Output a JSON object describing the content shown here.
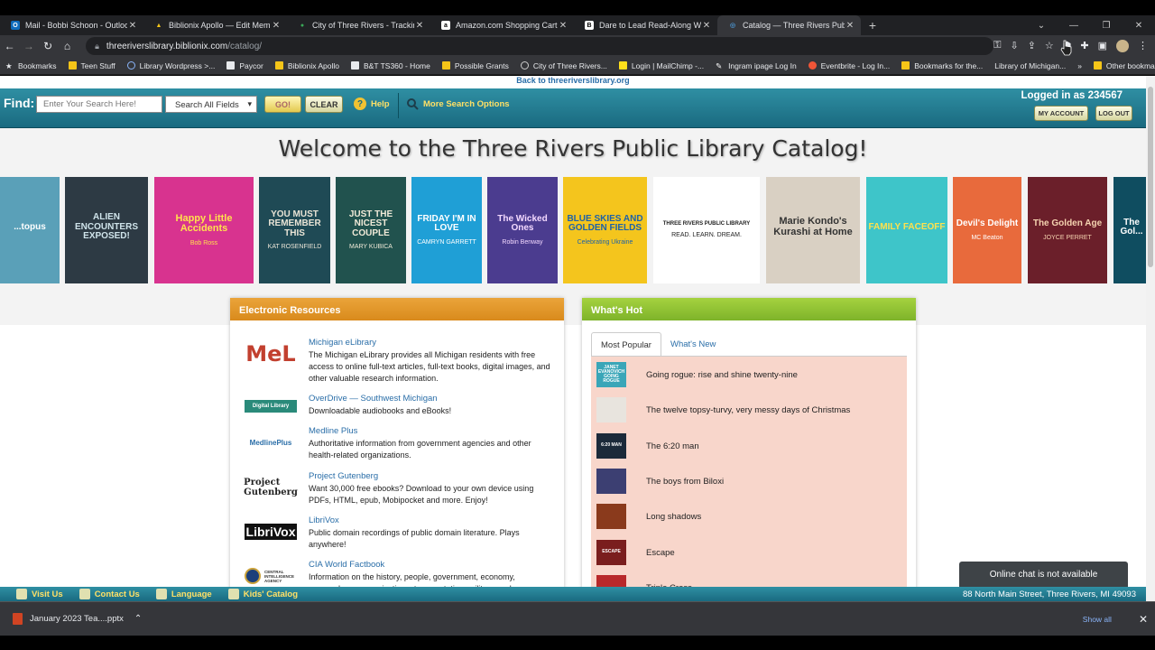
{
  "browser": {
    "tabs": [
      {
        "title": "Mail - Bobbi Schoon - Outlook",
        "color": "#0f6cbd",
        "glyph": "O"
      },
      {
        "title": "Biblionix Apollo — Edit Members",
        "color": "#f5c518",
        "glyph": "▲"
      },
      {
        "title": "City of Three Rivers - Tracking Lis",
        "color": "#3aa757",
        "glyph": "●"
      },
      {
        "title": "Amazon.com Shopping Cart",
        "color": "#ffffff",
        "glyph": "a"
      },
      {
        "title": "Dare to Lead Read-Along Worksh",
        "color": "#ffffff",
        "glyph": "B"
      },
      {
        "title": "Catalog — Three Rivers Public Lib",
        "color": "#4a90c8",
        "glyph": "◎"
      }
    ],
    "new_tab": "+",
    "url_host": "threeriverslibrary.biblionix.com",
    "url_path": "/catalog/",
    "bookmarks": [
      "Bookmarks",
      "Teen Stuff",
      "Library Wordpress >...",
      "Paycor",
      "Biblionix Apollo",
      "B&T TS360 - Home",
      "Possible Grants",
      "City of Three Rivers...",
      "Login | MailChimp -...",
      "Ingram ipage Log In",
      "Eventbrite - Log In...",
      "Bookmarks for the...",
      "Library of Michigan..."
    ],
    "bookmarks_more": "»",
    "other_bookmarks": "Other bookmarks"
  },
  "catalog": {
    "back_link": "Back to threeriverslibrary.org",
    "find_label": "Find:",
    "search_placeholder": "Enter Your Search Here!",
    "search_field": "Search All Fields",
    "go_label": "GO!",
    "clear_label": "CLEAR",
    "help_label": "Help",
    "more_options_label": "More Search Options",
    "logged_in": "Logged in as 234567",
    "my_account_label": "MY ACCOUNT",
    "log_out_label": "LOG OUT",
    "welcome": "Welcome to the Three Rivers Public Library Catalog!"
  },
  "covers": [
    {
      "title": "...topus",
      "author": "",
      "bg": "#5aa0b8",
      "fg": "#ffffff"
    },
    {
      "title": "ALIEN ENCOUNTERS EXPOSED!",
      "author": "",
      "bg": "#2d3a44",
      "fg": "#cfe3ea"
    },
    {
      "title": "Happy Little Accidents",
      "author": "Bob Ross",
      "bg": "#d8338f",
      "fg": "#ffe14d"
    },
    {
      "title": "YOU MUST REMEMBER THIS",
      "author": "KAT ROSENFIELD",
      "bg": "#1f4a55",
      "fg": "#e9e4d6"
    },
    {
      "title": "JUST THE NICEST COUPLE",
      "author": "MARY KUBICA",
      "bg": "#21524e",
      "fg": "#f0ead8"
    },
    {
      "title": "FRIDAY I'M IN LOVE",
      "author": "CAMRYN GARRETT",
      "bg": "#1f9fd6",
      "fg": "#ffffff"
    },
    {
      "title": "The Wicked Ones",
      "author": "Robin Benway",
      "bg": "#4b3c8f",
      "fg": "#f3d9ff"
    },
    {
      "title": "BLUE SKIES AND GOLDEN FIELDS",
      "author": "Celebrating Ukraine",
      "bg": "#f4c51d",
      "fg": "#1d62a8"
    },
    {
      "title": "THREE RIVERS PUBLIC LIBRARY",
      "author": "READ. LEARN. DREAM.",
      "bg": "#ffffff",
      "fg": "#222222"
    },
    {
      "title": "Marie Kondo's Kurashi at Home",
      "author": "",
      "bg": "#d9d0c3",
      "fg": "#333333"
    },
    {
      "title": "FAMILY FACEOFF",
      "author": "",
      "bg": "#3ec5c9",
      "fg": "#ffe14d"
    },
    {
      "title": "Devil's Delight",
      "author": "MC Beaton",
      "bg": "#e86a3c",
      "fg": "#ffffff"
    },
    {
      "title": "The Golden Age",
      "author": "JOYCE PERRET",
      "bg": "#6b1f2a",
      "fg": "#f5d3b0"
    },
    {
      "title": "The Gol...",
      "author": "",
      "bg": "#0f4d60",
      "fg": "#ffffff"
    }
  ],
  "electronic": {
    "heading": "Electronic Resources",
    "items": [
      {
        "logo": "MeL",
        "logo_color": "#c2402f",
        "title": "Michigan eLibrary",
        "desc": "The Michigan eLibrary provides all Michigan residents with free access to online full-text articles, full-text books, digital images, and other valuable research information."
      },
      {
        "logo": "Digital Library",
        "logo_color": "#2a8a7a",
        "title": "OverDrive — Southwest Michigan",
        "desc": "Downloadable audiobooks and eBooks!"
      },
      {
        "logo": "MedlinePlus",
        "logo_color": "#2a6ea8",
        "title": "Medline Plus",
        "desc": "Authoritative information from government agencies and other health-related organizations."
      },
      {
        "logo": "Project Gutenberg",
        "logo_color": "#222222",
        "title": "Project Gutenberg",
        "desc": "Want 30,000 free ebooks? Download to your own device using PDFs, HTML, epub, Mobipocket and more. Enjoy!"
      },
      {
        "logo": "LibriVox",
        "logo_color": "#ffffff",
        "title": "LibriVox",
        "desc": "Public domain recordings of public domain literature. Plays anywhere!"
      },
      {
        "logo": "CENTRAL INTELLIGENCE AGENCY",
        "logo_color": "#333333",
        "title": "CIA World Factbook",
        "desc": "Information on the history, people, government, economy, geography, communications, transportation, military, and..."
      }
    ]
  },
  "hot": {
    "heading": "What's Hot",
    "tabs": [
      "Most Popular",
      "What's New"
    ],
    "items": [
      {
        "title": "Going rogue: rise and shine twenty-nine",
        "thumb": "JANET EVANOVICH GOING ROGUE",
        "bg": "#3aa6b8"
      },
      {
        "title": "The twelve topsy-turvy, very messy days of Christmas",
        "thumb": "",
        "bg": "#e8e4de"
      },
      {
        "title": "The 6:20 man",
        "thumb": "6:20 MAN",
        "bg": "#1b2a3a"
      },
      {
        "title": "The boys from Biloxi",
        "thumb": "",
        "bg": "#3c3f72"
      },
      {
        "title": "Long shadows",
        "thumb": "",
        "bg": "#8a3a1c"
      },
      {
        "title": "Escape",
        "thumb": "ESCAPE",
        "bg": "#7a1e1e"
      },
      {
        "title": "Triple Cross",
        "thumb": "",
        "bg": "#b8282a"
      }
    ]
  },
  "chat_notice": "Online chat is not available",
  "footer": {
    "links": [
      "Visit Us",
      "Contact Us",
      "Language",
      "Kids' Catalog"
    ],
    "address": "88 North Main Street, Three Rivers, MI 49093"
  },
  "download": {
    "file": "January 2023 Tea....pptx",
    "show_all": "Show all"
  }
}
